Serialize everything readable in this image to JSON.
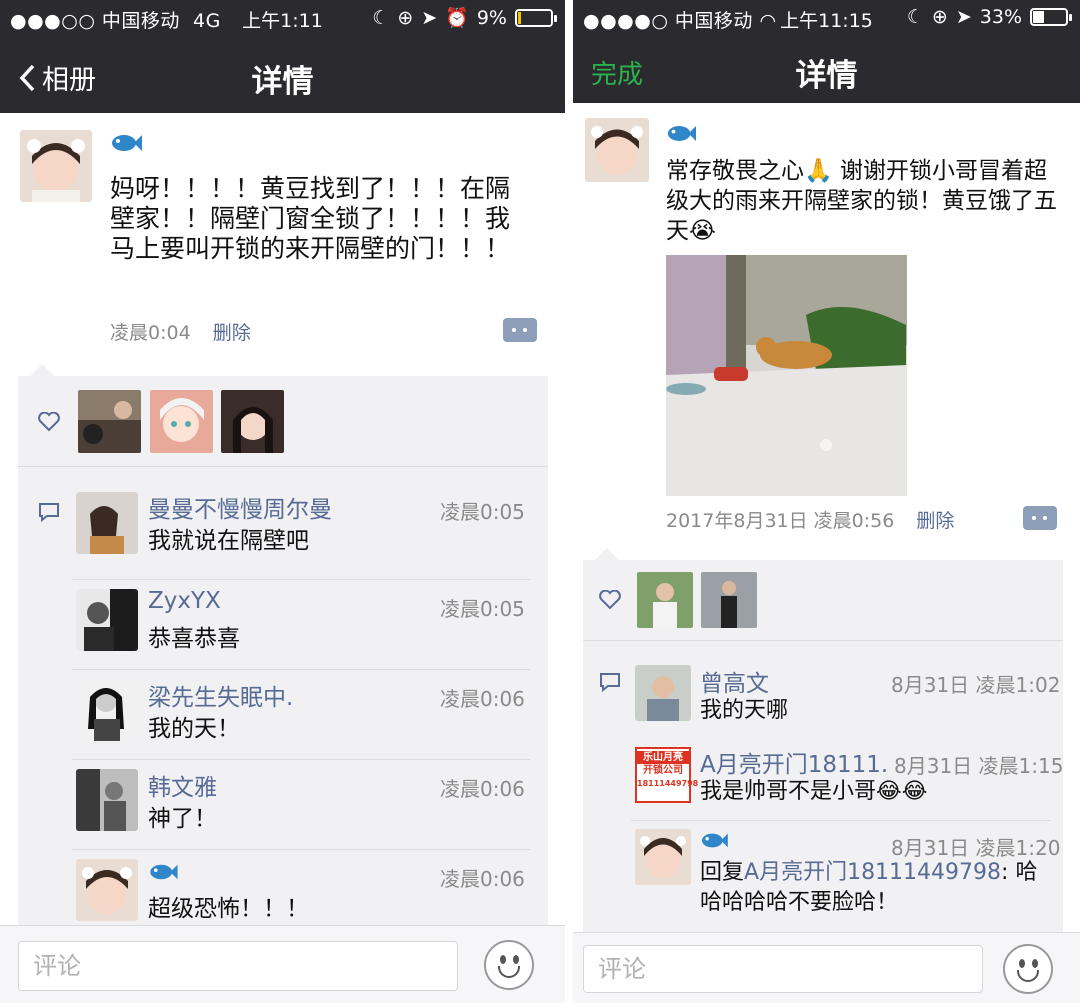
{
  "left": {
    "status": {
      "carrier": "●●●○○ 中国移动",
      "network": "4G",
      "time": "上午1:11",
      "battery": "9%",
      "battery_level": 0.09
    },
    "nav": {
      "back_label": "相册",
      "title": "详情"
    },
    "post": {
      "text": "妈呀！！！！黄豆找到了！！！在隔壁家！！隔壁门窗全锁了！！！！我马上要叫开锁的来开隔壁的门！！！",
      "time": "凌晨0:04",
      "delete_label": "删除"
    },
    "comments": [
      {
        "name": "曼曼不慢慢周尔曼",
        "time": "凌晨0:05",
        "text": "我就说在隔壁吧"
      },
      {
        "name": "ZyxYX",
        "time": "凌晨0:05",
        "text": "恭喜恭喜"
      },
      {
        "name": "梁先生失眠中.",
        "time": "凌晨0:06",
        "text": "我的天！"
      },
      {
        "name": "韩文雅",
        "time": "凌晨0:06",
        "text": "神了！"
      },
      {
        "name": "",
        "time": "凌晨0:06",
        "text": "超级恐怖！！！"
      }
    ],
    "comment_placeholder": "评论"
  },
  "right": {
    "status": {
      "carrier": "●●●●○ 中国移动",
      "time": "上午11:15",
      "battery": "33%",
      "battery_level": 0.33
    },
    "nav": {
      "done_label": "完成",
      "title": "详情"
    },
    "post": {
      "text": "常存敬畏之心🙏 谢谢开锁小哥冒着超级大的雨来开隔壁家的锁！黄豆饿了五天😭",
      "time": "2017年8月31日 凌晨0:56",
      "delete_label": "删除"
    },
    "comments": [
      {
        "name": "曾高文",
        "time": "8月31日 凌晨1:02",
        "text": "我的天哪"
      },
      {
        "name": "A月亮开门18111...",
        "time": "8月31日 凌晨1:15",
        "text": "我是帅哥不是小哥😂😂"
      },
      {
        "name": "",
        "time": "8月31日 凌晨1:20",
        "reply_prefix": "回复",
        "reply_to": "A月亮开门18111449798",
        "text": ": 哈哈哈哈哈不要脸哈！"
      }
    ],
    "stamp_text": [
      "乐山月亮",
      "开锁公司",
      "18111449798"
    ],
    "comment_placeholder": "评论"
  },
  "colors": {
    "header": "#2b2b2f",
    "link": "#576b95",
    "done": "#2bb24c",
    "box": "#f1f1f3"
  }
}
